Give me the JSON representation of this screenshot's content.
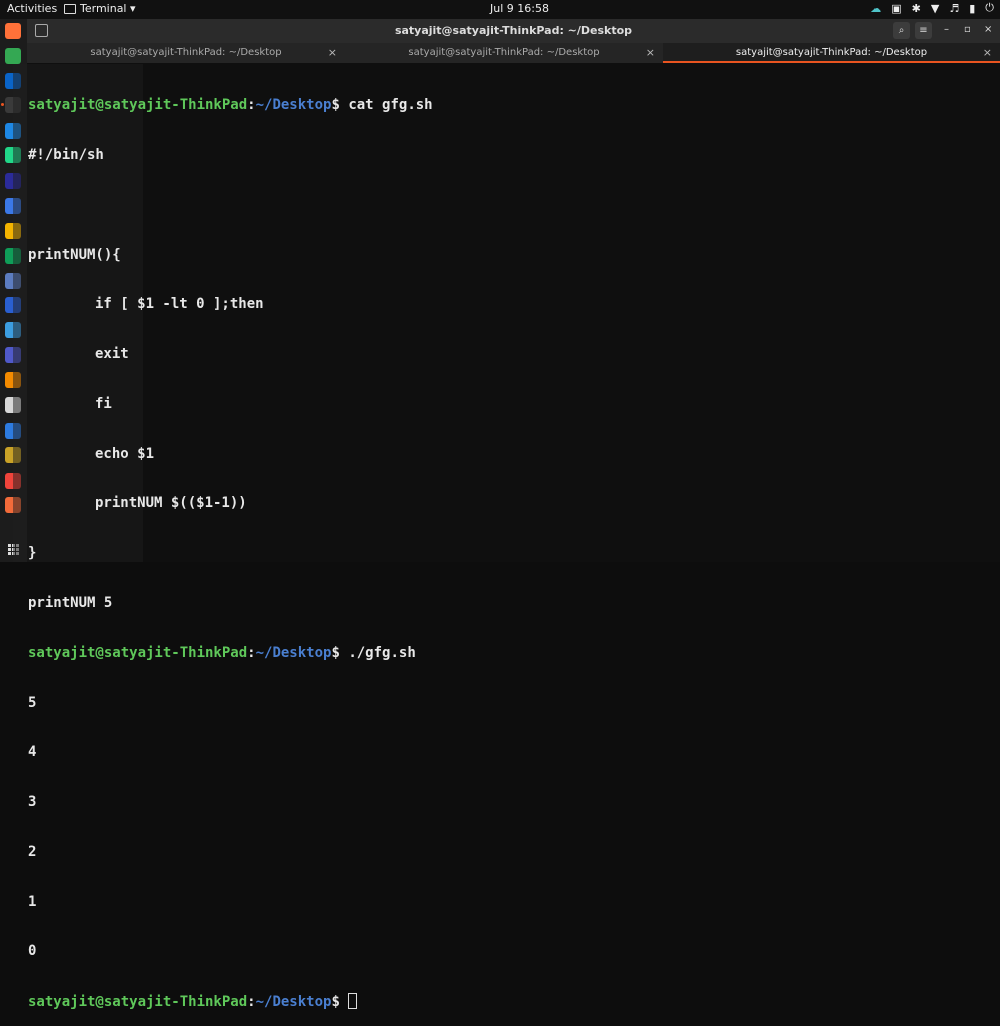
{
  "topbar": {
    "activities": "Activities",
    "app_menu": "Terminal ▾",
    "clock": "Jul 9  16:58",
    "tray_icons": [
      "cloud-icon",
      "screen-icon",
      "accessibility-icon",
      "network-icon",
      "volume-icon",
      "battery-icon",
      "power-icon"
    ]
  },
  "dock": {
    "icons": [
      {
        "name": "firefox-icon",
        "color": "#ff7139"
      },
      {
        "name": "chrome-icon",
        "color": "#34a853"
      },
      {
        "name": "outlook-icon",
        "color": "#0a64c8"
      },
      {
        "name": "terminal-icon",
        "color": "#3a3a3a",
        "active": true
      },
      {
        "name": "vscode-icon",
        "color": "#1e88e5"
      },
      {
        "name": "pycharm-icon",
        "color": "#21d789"
      },
      {
        "name": "intellij-icon",
        "color": "#2b2b9a"
      },
      {
        "name": "docs-icon",
        "color": "#3b78e7"
      },
      {
        "name": "slides-icon",
        "color": "#f4b400"
      },
      {
        "name": "sheets-icon",
        "color": "#0f9d58"
      },
      {
        "name": "calc-icon",
        "color": "#5c7cc0"
      },
      {
        "name": "editor-icon",
        "color": "#2a5fd0"
      },
      {
        "name": "monitor-icon",
        "color": "#3c9de0"
      },
      {
        "name": "teams-icon",
        "color": "#5059c9"
      },
      {
        "name": "vlc-icon",
        "color": "#f48b00"
      },
      {
        "name": "files-icon",
        "color": "#d8d8d8"
      },
      {
        "name": "wps-icon",
        "color": "#2d7be0"
      },
      {
        "name": "archive-icon",
        "color": "#c9a227"
      },
      {
        "name": "anydesk-icon",
        "color": "#ef443b"
      },
      {
        "name": "postman-icon",
        "color": "#f26b3a"
      }
    ]
  },
  "window": {
    "title": "satyajit@satyajit-ThinkPad: ~/Desktop",
    "tabs": [
      {
        "label": "satyajit@satyajit-ThinkPad: ~/Desktop",
        "active": false
      },
      {
        "label": "satyajit@satyajit-ThinkPad: ~/Desktop",
        "active": false
      },
      {
        "label": "satyajit@satyajit-ThinkPad: ~/Desktop",
        "active": true
      }
    ],
    "tab_close": "×",
    "search_icon": "⌕",
    "menu_icon": "≡",
    "minimize": "–",
    "maximize": "▫",
    "close": "×"
  },
  "terminal": {
    "prompt_user": "satyajit@satyajit-ThinkPad",
    "prompt_sep": ":",
    "prompt_path": "~/Desktop",
    "prompt_end": "$ ",
    "cmd1": "cat gfg.sh",
    "cat_output": [
      "#!/bin/sh",
      "",
      "printNUM(){",
      "\tif [ $1 -lt 0 ];then",
      "\texit",
      "\tfi",
      "\techo $1",
      "\tprintNUM $(($1-1))",
      "}",
      "printNUM 5"
    ],
    "cmd2": "./gfg.sh",
    "run_output": [
      "5",
      "4",
      "3",
      "2",
      "1",
      "0"
    ]
  }
}
